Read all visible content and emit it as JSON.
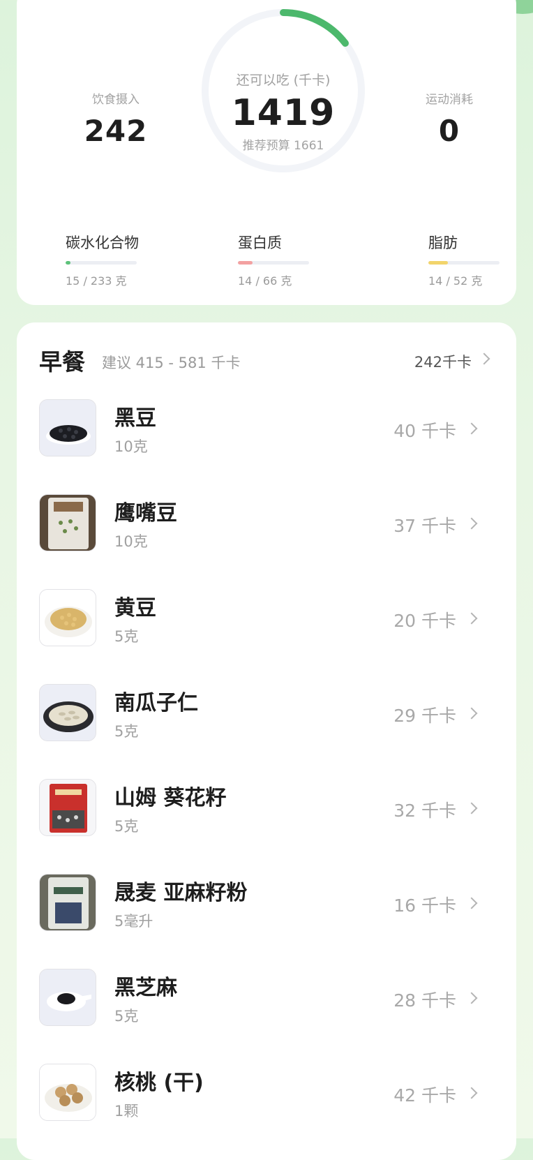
{
  "summary": {
    "intake_label": "饮食摄入",
    "intake_value": "242",
    "remaining_label": "还可以吃 (千卡)",
    "remaining_value": "1419",
    "budget_text": "推荐预算 1661",
    "exercise_label": "运动消耗",
    "exercise_value": "0",
    "ring_progress": 0.146,
    "ring_color": "#4cb86c",
    "ring_track_color": "#f2f4f8"
  },
  "macros": {
    "carb": {
      "name": "碳水化合物",
      "amount": "15 / 233 克",
      "progress": 0.064,
      "color": "#5dc27a"
    },
    "protein": {
      "name": "蛋白质",
      "amount": "14 / 66 克",
      "progress": 0.21,
      "color": "#f3a1a1"
    },
    "fat": {
      "name": "脂肪",
      "amount": "14 / 52 克",
      "progress": 0.27,
      "color": "#f2d46b"
    }
  },
  "meal": {
    "title": "早餐",
    "suggestion": "建议 415 - 581 千卡",
    "total": "242千卡",
    "items": [
      {
        "name": "黑豆",
        "amount": "10克",
        "kcal": "40 千卡",
        "icon": "black-beans-photo"
      },
      {
        "name": "鹰嘴豆",
        "amount": "10克",
        "kcal": "37 千卡",
        "icon": "chickpea-bag-photo"
      },
      {
        "name": "黄豆",
        "amount": "5克",
        "kcal": "20 千卡",
        "icon": "soybeans-photo"
      },
      {
        "name": "南瓜子仁",
        "amount": "5克",
        "kcal": "29 千卡",
        "icon": "pumpkin-seeds-photo"
      },
      {
        "name": "山姆 葵花籽",
        "amount": "5克",
        "kcal": "32 千卡",
        "icon": "sunflower-seeds-bag-photo"
      },
      {
        "name": "晟麦 亚麻籽粉",
        "amount": "5毫升",
        "kcal": "16 千卡",
        "icon": "flaxseed-powder-bag-photo"
      },
      {
        "name": "黑芝麻",
        "amount": "5克",
        "kcal": "28 千卡",
        "icon": "black-sesame-photo"
      },
      {
        "name": "核桃 (干)",
        "amount": "1颗",
        "kcal": "42 千卡",
        "icon": "walnuts-photo"
      }
    ]
  }
}
